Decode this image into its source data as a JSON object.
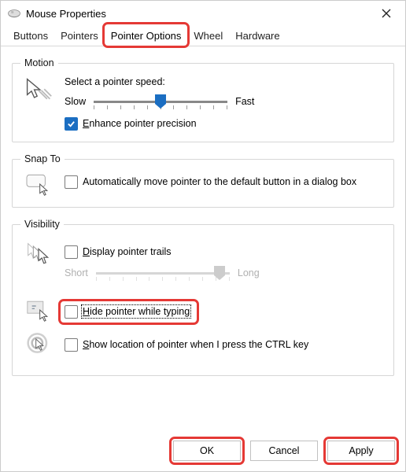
{
  "window": {
    "title": "Mouse Properties"
  },
  "tabs": [
    "Buttons",
    "Pointers",
    "Pointer Options",
    "Wheel",
    "Hardware"
  ],
  "active_tab_index": 2,
  "motion": {
    "legend": "Motion",
    "label": "Select a pointer speed:",
    "slow": "Slow",
    "fast": "Fast",
    "speed_value": 5,
    "speed_max": 10,
    "enhance_checked": true,
    "enhance_label_u": "E",
    "enhance_label_rest": "nhance pointer precision"
  },
  "snapto": {
    "legend": "Snap To",
    "checked": false,
    "label": "Automatically move pointer to the default button in a dialog box"
  },
  "visibility": {
    "legend": "Visibility",
    "trails": {
      "checked": false,
      "label_u": "D",
      "label_rest": "isplay pointer trails",
      "short": "Short",
      "long": "Long",
      "value": 9,
      "max": 10
    },
    "hide": {
      "checked": false,
      "label_u": "H",
      "label_rest": "ide pointer while typing"
    },
    "ctrl": {
      "checked": false,
      "label_u": "S",
      "label_rest": "how location of pointer when I press the CTRL key"
    }
  },
  "buttons": {
    "ok": "OK",
    "cancel": "Cancel",
    "apply_u": "A",
    "apply_rest": "pply"
  },
  "highlights": {
    "tab": true,
    "hide": true,
    "ok": true,
    "apply": true
  }
}
